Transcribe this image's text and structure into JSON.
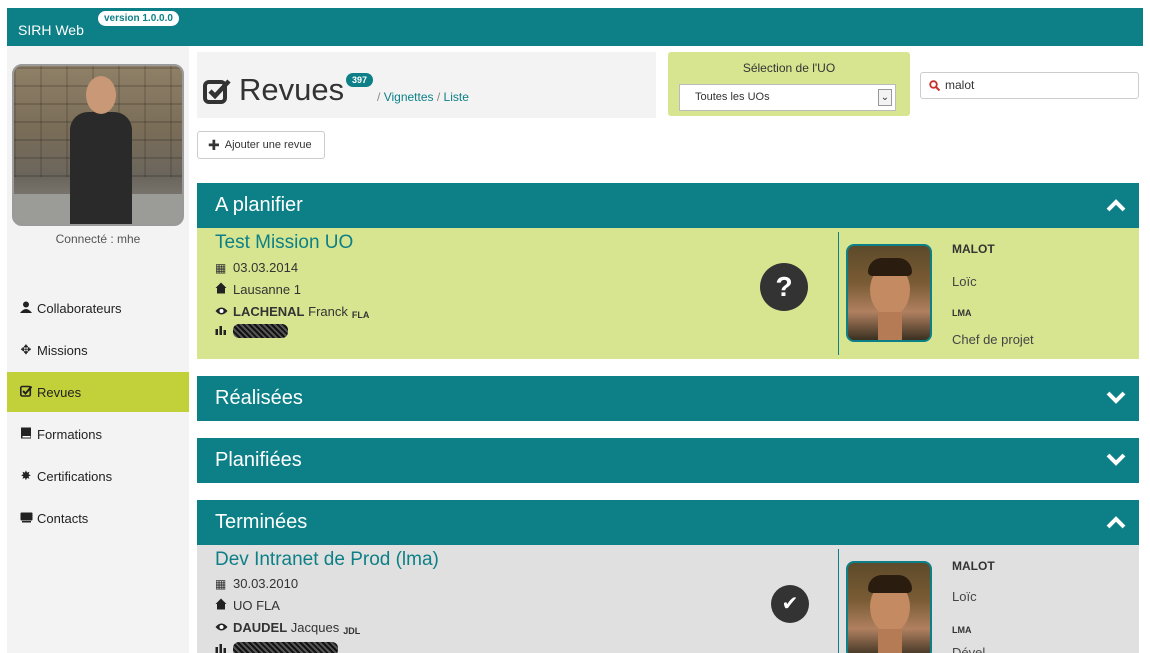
{
  "app": {
    "name": "SIRH Web",
    "version": "version 1.0.0.0"
  },
  "sidebar": {
    "connected": "Connecté : mhe",
    "items": [
      {
        "label": "Collaborateurs",
        "icon": "user-icon",
        "active": false
      },
      {
        "label": "Missions",
        "icon": "move-icon",
        "active": false
      },
      {
        "label": "Revues",
        "icon": "check-square-icon",
        "active": true
      },
      {
        "label": "Formations",
        "icon": "book-icon",
        "active": false
      },
      {
        "label": "Certifications",
        "icon": "certificate-icon",
        "active": false
      },
      {
        "label": "Contacts",
        "icon": "contact-card-icon",
        "active": false
      }
    ]
  },
  "header": {
    "title": "Revues",
    "count": "397",
    "view_sep1": "/",
    "view_vignettes": "Vignettes",
    "view_sep2": "/",
    "view_liste": "Liste"
  },
  "uo": {
    "label": "Sélection de l'UO",
    "selected": "Toutes les UOs"
  },
  "search": {
    "value": "malot"
  },
  "add_button": {
    "label": "Ajouter une revue"
  },
  "sections": {
    "a_planifier": "A planifier",
    "realisees": "Réalisées",
    "planifiees": "Planifiées",
    "terminees": "Terminées"
  },
  "cards": [
    {
      "title": "Test Mission UO",
      "date": "03.03.2014",
      "location": "Lausanne 1",
      "reviewer_last": "LACHENAL",
      "reviewer_first": "Franck",
      "reviewer_abbr": "FLA",
      "status_glyph": "?",
      "person_last": "MALOT",
      "person_first": "Loïc",
      "person_abbr": "LMA",
      "person_role": "Chef de projet"
    },
    {
      "title": "Dev Intranet de Prod (lma)",
      "date": "30.03.2010",
      "location": "UO FLA",
      "reviewer_last": "DAUDEL",
      "reviewer_first": "Jacques",
      "reviewer_abbr": "JDL",
      "status_glyph": "✔",
      "person_last": "MALOT",
      "person_first": "Loïc",
      "person_abbr": "LMA",
      "person_role": "Dével..."
    }
  ],
  "colors": {
    "teal": "#0d8087",
    "lime": "#c2d03a",
    "card_green": "#d8e590",
    "card_gray": "#e0e0e0"
  }
}
